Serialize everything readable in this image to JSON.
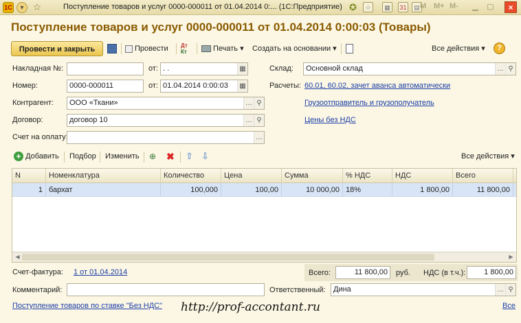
{
  "window": {
    "title": "Поступление товаров и услуг 0000-000011 от 01.04.2014 0:... (1С:Предприятие)",
    "logo": "1С",
    "win_buttons": [
      "M",
      "M+",
      "M-"
    ],
    "close": "×"
  },
  "document_title": "Поступление товаров и услуг 0000-000011 от 01.04.2014 0:00:03 (Товары)",
  "toolbar": {
    "post_and_close": "Провести и закрыть",
    "post": "Провести",
    "print": "Печать",
    "create_based_on": "Создать на основании",
    "all_actions": "Все действия",
    "help": "?"
  },
  "form": {
    "invoice_label": "Накладная №:",
    "invoice_value": "",
    "invoice_from_label": "от:",
    "invoice_date": " .  .",
    "number_label": "Номер:",
    "number_value": "0000-000011",
    "number_from_label": "от:",
    "number_date": "01.04.2014  0:00:03",
    "counterparty_label": "Контрагент:",
    "counterparty_value": "ООО «Ткани»",
    "contract_label": "Договор:",
    "contract_value": "договор 10",
    "payment_account_label": "Счет на оплату:",
    "payment_account_value": "",
    "warehouse_label": "Склад:",
    "warehouse_value": "Основной склад",
    "settlements_label": "Расчеты:",
    "settlements_link": "60.01, 60.02, зачет аванса автоматически",
    "shipper_link": "Грузоотправитель и грузополучатель",
    "prices_link": "Цены без НДС"
  },
  "items_toolbar": {
    "add": "Добавить",
    "pick": "Подбор",
    "edit": "Изменить",
    "all_actions": "Все действия"
  },
  "table": {
    "columns": [
      "N",
      "Номенклатура",
      "Количество",
      "Цена",
      "Сумма",
      "% НДС",
      "НДС",
      "Всего"
    ],
    "rows": [
      [
        "1",
        "бархат",
        "100,000",
        "100,00",
        "10 000,00",
        "18%",
        "1 800,00",
        "11 800,00"
      ]
    ]
  },
  "bottom": {
    "invoice_label": "Счет-фактура:",
    "invoice_link": "1 от 01.04.2014",
    "total_label": "Всего:",
    "total_value": "11 800,00",
    "currency": "руб.",
    "vat_label": "НДС (в т.ч.):",
    "vat_value": "1 800,00",
    "comment_label": "Комментарий:",
    "comment_value": "",
    "responsible_label": "Ответственный:",
    "responsible_value": "Дина",
    "receipt_link": "Поступление товаров по ставке \"Без НДС\"",
    "watermark": "http://prof-accontant.ru",
    "all_link": "Все"
  }
}
